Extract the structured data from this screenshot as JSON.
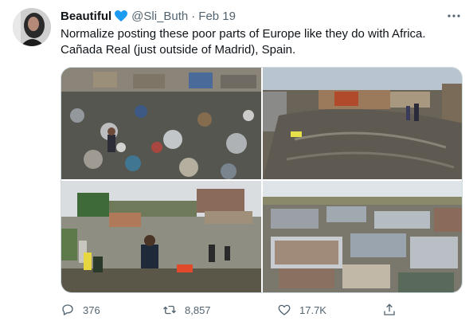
{
  "tweet": {
    "display_name": "Beautiful",
    "handle": "@Sli_Buth",
    "separator": "·",
    "date": "Feb 19",
    "text_line1": "Normalize posting these poor parts of Europe like they do with Africa.",
    "text_line2": "Cañada Real (just outside of Madrid), Spain.",
    "verified_icon": "verified-heart-icon",
    "accent_color": "#1d9bf0"
  },
  "media": {
    "photos": [
      {
        "name": "garbage-dump-photo"
      },
      {
        "name": "muddy-street-photo"
      },
      {
        "name": "flooded-camp-photo"
      },
      {
        "name": "shanty-town-photo"
      }
    ]
  },
  "actions": {
    "reply_count": "376",
    "retweet_count": "8,857",
    "like_count": "17.7K",
    "icons": [
      "reply-icon",
      "retweet-icon",
      "like-icon",
      "share-icon"
    ]
  }
}
